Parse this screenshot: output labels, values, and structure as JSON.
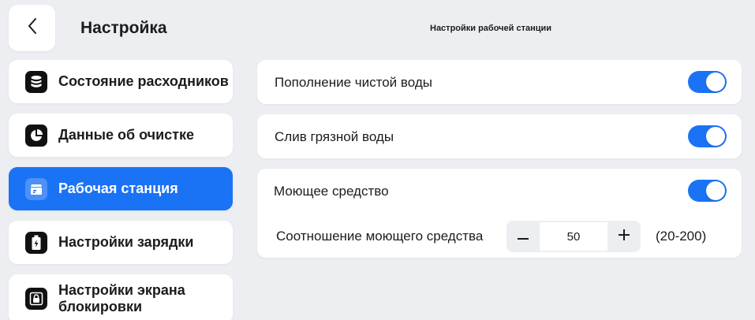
{
  "header": {
    "title": "Настройка",
    "section_title": "Настройки рабочей станции"
  },
  "sidebar": {
    "items": [
      {
        "label": "Состояние расходников",
        "icon": "database-icon",
        "active": false
      },
      {
        "label": "Данные об очистке",
        "icon": "pie-chart-icon",
        "active": false
      },
      {
        "label": "Рабочая станция",
        "icon": "station-icon",
        "active": true
      },
      {
        "label": "Настройки зарядки",
        "icon": "battery-charging-icon",
        "active": false
      },
      {
        "label": "Настройки экрана блокировки",
        "icon": "lock-screen-icon",
        "active": false
      }
    ]
  },
  "settings": {
    "clean_water": {
      "label": "Пополнение чистой воды",
      "enabled": true
    },
    "dirty_water": {
      "label": "Слив грязной воды",
      "enabled": true
    },
    "detergent": {
      "label": "Моющее средство",
      "enabled": true,
      "ratio_label": "Соотношение моющего средства",
      "ratio_value": "50",
      "ratio_range": "(20-200)"
    }
  },
  "colors": {
    "accent": "#1a73f5",
    "background": "#eceef2",
    "card": "#ffffff"
  }
}
